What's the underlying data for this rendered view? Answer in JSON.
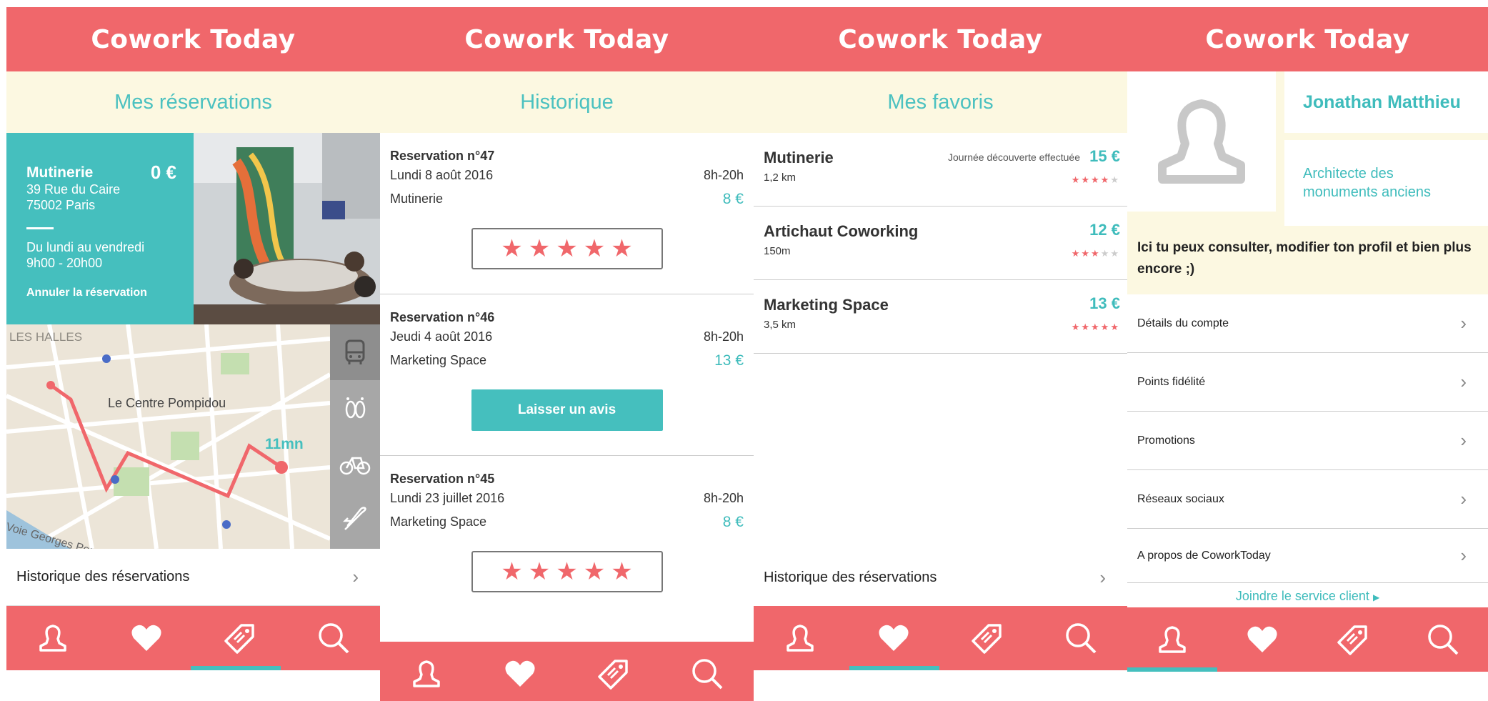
{
  "app": {
    "title": "Cowork Today"
  },
  "reservations_screen": {
    "subtitle": "Mes réservations",
    "card": {
      "name": "Mutinerie",
      "price": "0 €",
      "address_line1": "39 Rue du Caire",
      "address_line2": "75002 Paris",
      "days": "Du lundi au vendredi",
      "hours": "9h00 - 20h00",
      "cancel": "Annuler la réservation"
    },
    "map": {
      "district": "LES HALLES",
      "landmark": "Le Centre Pompidou",
      "duration": "11mn",
      "street": "Voie Georges Pomp"
    },
    "history_link": "Historique des réservations"
  },
  "history_screen": {
    "subtitle": "Historique",
    "items": [
      {
        "title": "Reservation n°47",
        "date": "Lundi 8 août 2016",
        "hours": "8h-20h",
        "place": "Mutinerie",
        "price": "8 €",
        "action": "stars"
      },
      {
        "title": "Reservation n°46",
        "date": "Jeudi 4 août 2016",
        "hours": "8h-20h",
        "place": "Marketing Space",
        "price": "13 €",
        "action": "review"
      },
      {
        "title": "Reservation n°45",
        "date": "Lundi 23 juillet 2016",
        "hours": "8h-20h",
        "place": "Marketing Space",
        "price": "8 €",
        "action": "stars"
      }
    ],
    "review_button": "Laisser un avis"
  },
  "favorites_screen": {
    "subtitle": "Mes favoris",
    "items": [
      {
        "name": "Mutinerie",
        "distance": "1,2 km",
        "note": "Journée découverte effectuée",
        "price": "15 €",
        "rating": 4.5
      },
      {
        "name": "Artichaut Coworking",
        "distance": "150m",
        "note": "",
        "price": "12 €",
        "rating": 3.5
      },
      {
        "name": "Marketing Space",
        "distance": "3,5 km",
        "note": "",
        "price": "13 €",
        "rating": 5
      }
    ],
    "history_link": "Historique des réservations"
  },
  "profile_screen": {
    "name": "Jonathan Matthieu",
    "job_line1": "Architecte des",
    "job_line2": "monuments anciens",
    "intro": "Ici tu peux consulter, modifier ton profil et bien plus encore ;)",
    "menu": [
      "Détails du compte",
      "Points fidélité",
      "Promotions",
      "Réseaux sociaux",
      "A propos de CoworkToday"
    ],
    "support": "Joindre le service client"
  },
  "tabbar": {
    "tabs": [
      "profile-icon",
      "heart-icon",
      "tag-icon",
      "search-icon"
    ]
  },
  "colors": {
    "brand": "#f0676b",
    "accent": "#45bfbe",
    "cream": "#fcf8e1"
  }
}
